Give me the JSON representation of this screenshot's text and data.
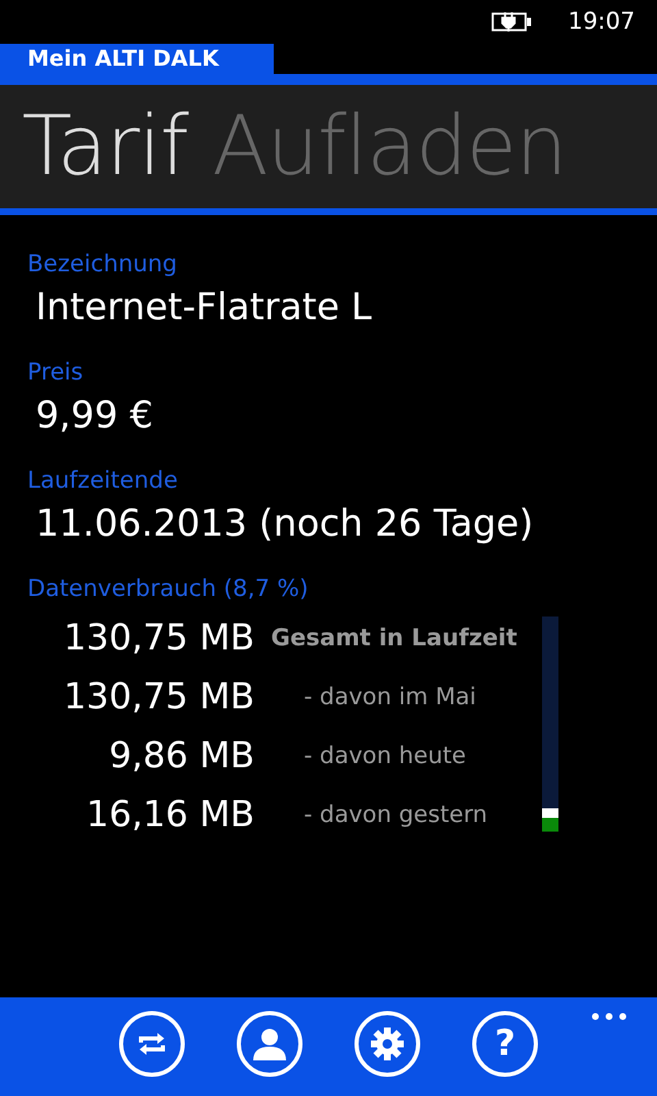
{
  "status_bar": {
    "time": "19:07"
  },
  "app_title": "Mein ALTI DALK",
  "pivot": [
    {
      "label": "Tarif",
      "selected": true
    },
    {
      "label": "Aufladen",
      "selected": false
    }
  ],
  "fields": [
    {
      "label": "Bezeichnung",
      "value": "Internet-Flatrate L"
    },
    {
      "label": "Preis",
      "value": "9,99 €"
    },
    {
      "label": "Laufzeitende",
      "value": "11.06.2013 (noch 26 Tage)"
    }
  ],
  "usage": {
    "label": "Datenverbrauch (8,7 %)",
    "level": 0.11,
    "rows": [
      {
        "amount": "130,75 MB",
        "caption": "Gesamt in Laufzeit",
        "kind": "total"
      },
      {
        "amount": "130,75 MB",
        "caption": "- davon im Mai",
        "kind": "part"
      },
      {
        "amount": "9,86 MB",
        "caption": "- davon heute",
        "kind": "part"
      },
      {
        "amount": "16,16 MB",
        "caption": "- davon gestern",
        "kind": "part"
      }
    ]
  },
  "app_bar": {
    "buttons": [
      {
        "kind": "sync"
      },
      {
        "kind": "account"
      },
      {
        "kind": "settings"
      },
      {
        "kind": "help",
        "text": "?"
      }
    ]
  }
}
